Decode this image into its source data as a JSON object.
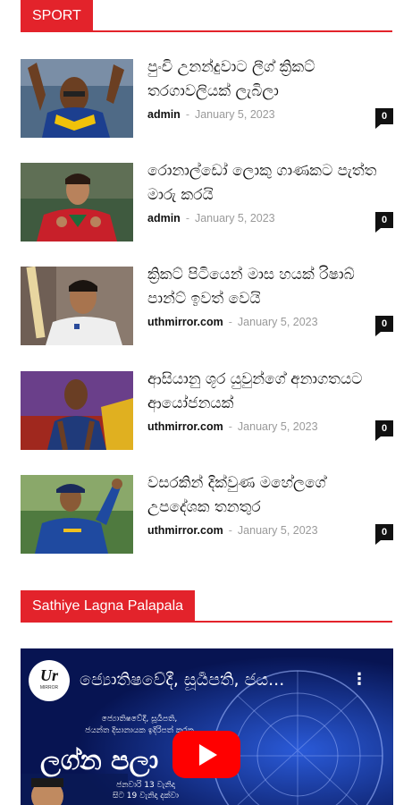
{
  "sections": {
    "sport": {
      "label": "SPORT"
    },
    "sathiye": {
      "label": "Sathiye Lagna Palapala"
    }
  },
  "articles": [
    {
      "headline": "පුංචි උනන්දුවාට ලීග් ක්‍රිකට් තරගාවලියක් ලැබිලා",
      "author": "admin",
      "date": "January 5, 2023",
      "comments": "0"
    },
    {
      "headline": "රොනාල්ඩෝ ලොකු ගාණකට පැත්ත මාරු කරයි",
      "author": "admin",
      "date": "January 5, 2023",
      "comments": "0"
    },
    {
      "headline": "ක්‍රිකට් පිටියෙන් මාස හයක් රිෂාබ් පාන්ට් ඉවත් වෙයි",
      "author": "uthmirror.com",
      "date": "January 5, 2023",
      "comments": "0"
    },
    {
      "headline": "ආසියානු ශූර යුවුන්ගේ අනාගතයට ආයෝජනයක්",
      "author": "uthmirror.com",
      "date": "January 5, 2023",
      "comments": "0"
    },
    {
      "headline": "වසරකින් දික්වුණ මහේලගේ උපදේශක තනතුර",
      "author": "uthmirror.com",
      "date": "January 5, 2023",
      "comments": "0"
    }
  ],
  "video": {
    "title": "ජ්‍යොතිෂවේදී, සූර්‍යපති, ජය...",
    "more": "⋮",
    "logo_text": "MIRROR",
    "line1": "ජ්‍යොතිෂවේදී, සූර්‍යපති,",
    "line2": "ජයන්ත දිසානායක ඉදිරිපත් කරන",
    "big": "ලග්න පලා",
    "date1": "ජනවාරි 13 වැනිදා",
    "date2": "සිට 19 වැනිදා දක්වා"
  },
  "colors": {
    "accent": "#e3232b"
  }
}
